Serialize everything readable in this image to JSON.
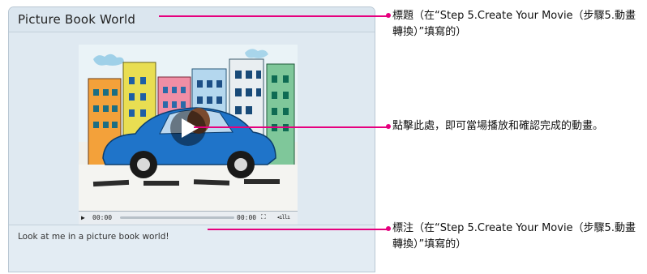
{
  "panel": {
    "title": "Picture Book World",
    "caption": "Look at me in a picture book world!"
  },
  "player": {
    "time_current": "00:00",
    "time_total": "00:00",
    "play_icon": "play-icon",
    "fullscreen_icon": "fullscreen-icon",
    "volume_icon": "volume-icon",
    "play_overlay_icon": "big-play-icon"
  },
  "annotations": {
    "title_note": "標題（在“Step 5.Create Your Movie（步驟5.動畫轉換）”填寫的）",
    "play_note": "點擊此處，即可當場播放和確認完成的動畫。",
    "caption_note": "標注（在“Step 5.Create Your Movie（步驟5.動畫轉換）”填寫的）"
  },
  "colors": {
    "callout": "#e6007e",
    "panel_bg": "#dfe9f1"
  }
}
